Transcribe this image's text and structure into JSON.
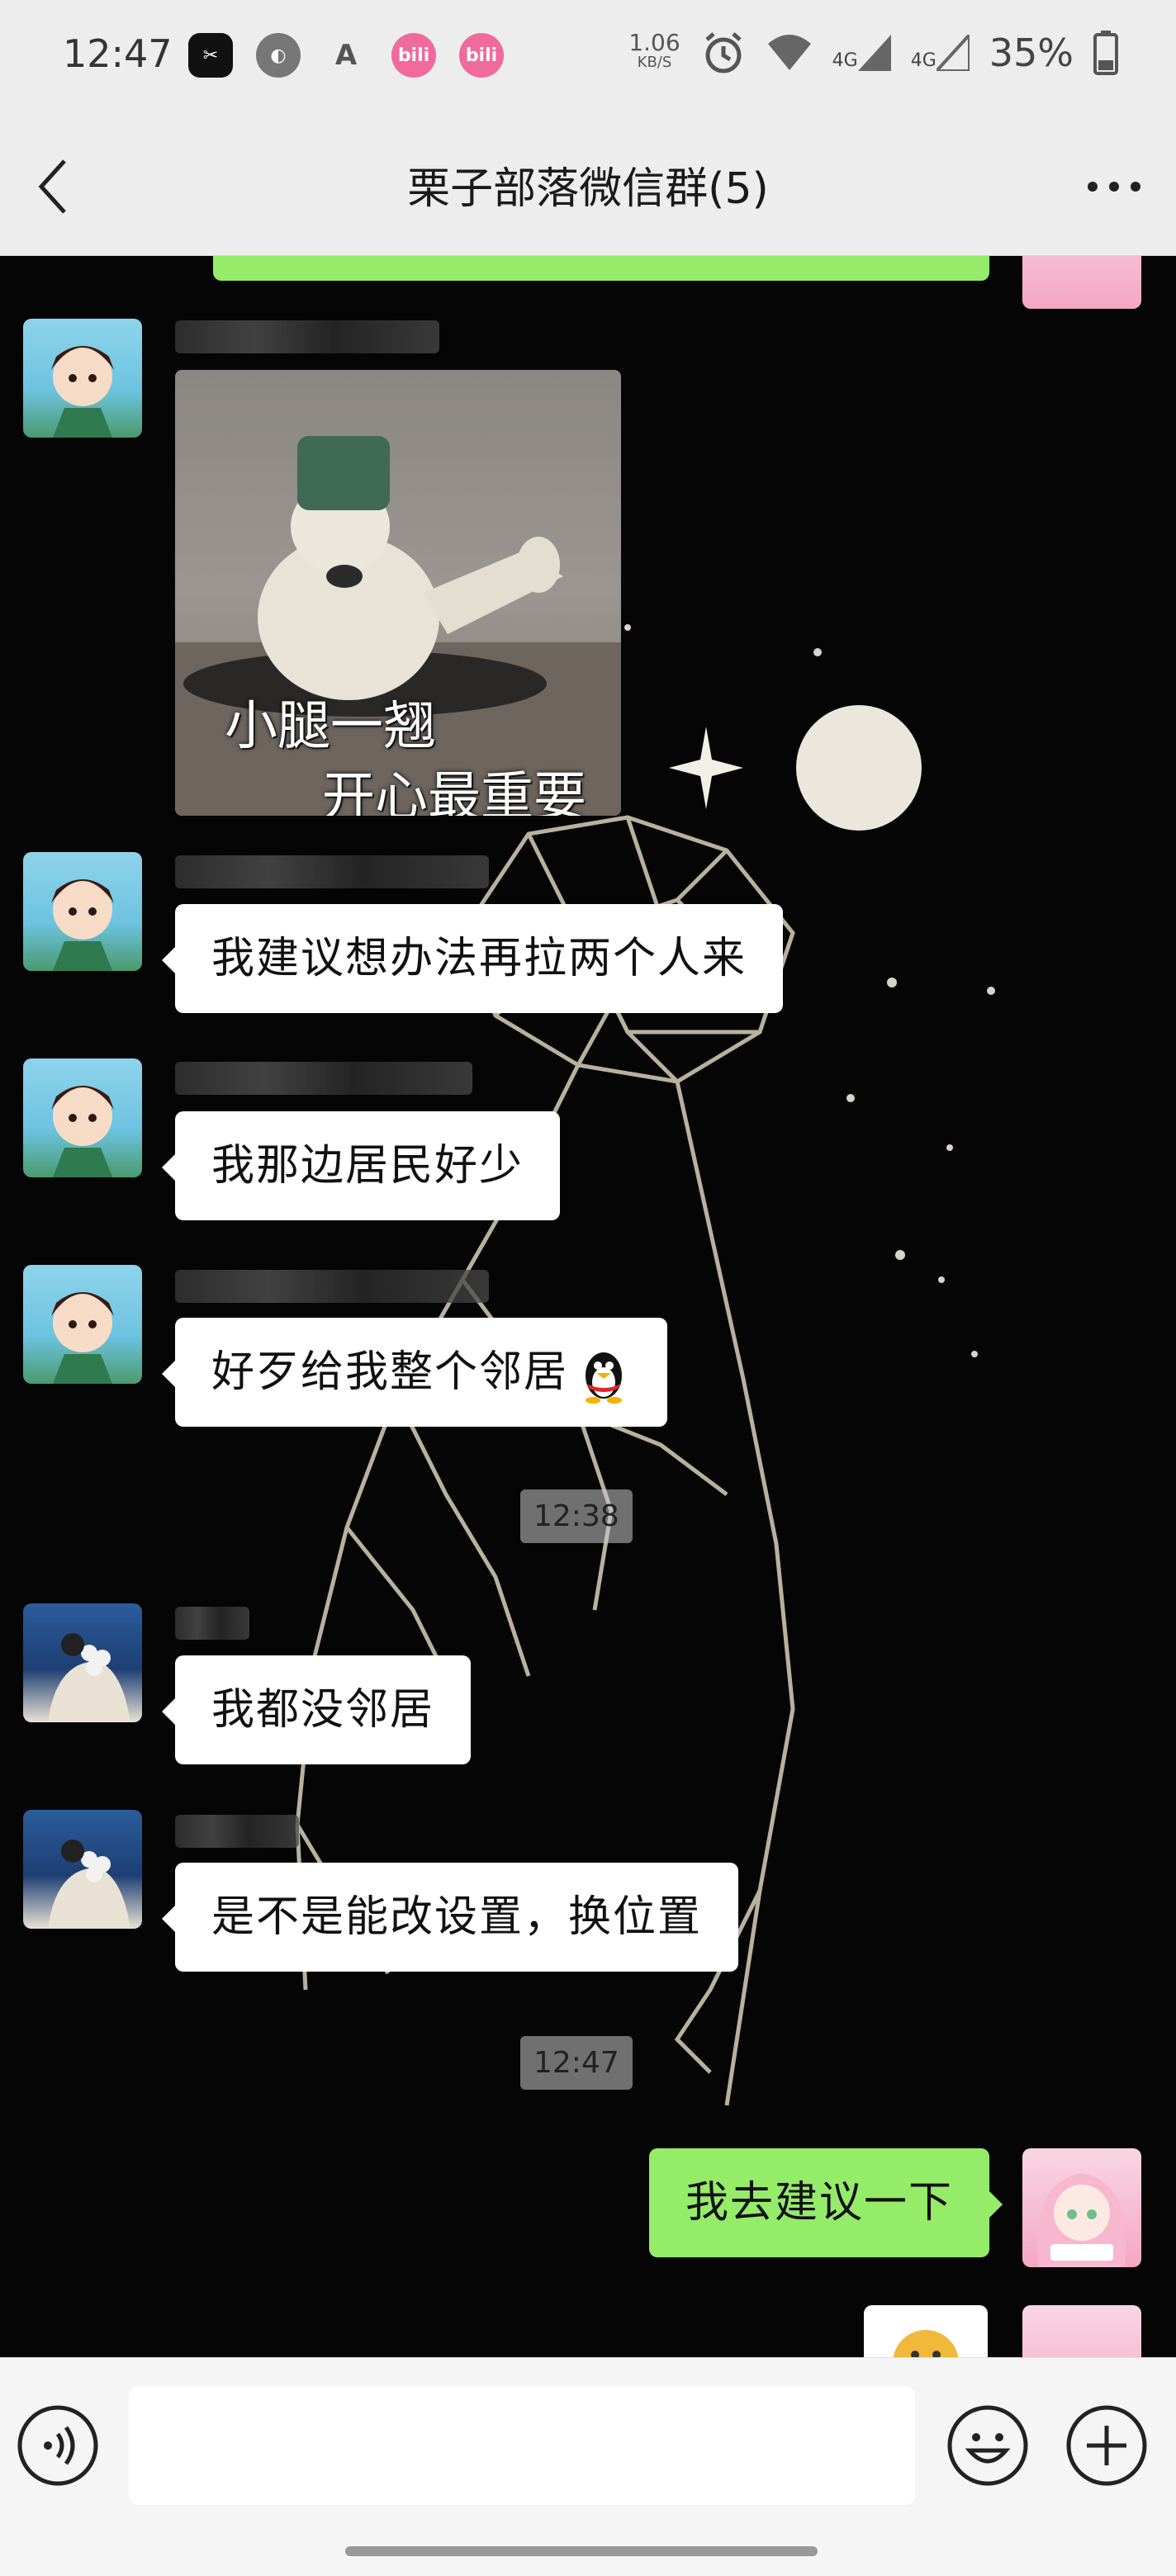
{
  "status_bar": {
    "time": "12:47",
    "net_speed_value": "1.06",
    "net_speed_unit": "KB/S",
    "battery": "35%",
    "signal_1": "4G",
    "signal_2": "4G",
    "app_icons": [
      "capcut-icon",
      "moon-icon",
      "font-icon",
      "bilibili-icon",
      "bilibili-icon"
    ]
  },
  "header": {
    "title": "栗子部落微信群(5)"
  },
  "messages": [
    {
      "type": "sticker",
      "sender_side": "left",
      "line1": "小腿一翘",
      "line2": "开心最重要"
    },
    {
      "type": "text",
      "sender_side": "left",
      "text": "我建议想办法再拉两个人来"
    },
    {
      "type": "text",
      "sender_side": "left",
      "text": "我那边居民好少"
    },
    {
      "type": "text",
      "sender_side": "left",
      "text": "好歹给我整个邻居"
    },
    {
      "type": "time",
      "text": "12:38"
    },
    {
      "type": "text",
      "sender_side": "left",
      "text": "我都没邻居"
    },
    {
      "type": "text",
      "sender_side": "left",
      "text": "是不是能改设置，换位置"
    },
    {
      "type": "time",
      "text": "12:47"
    },
    {
      "type": "text",
      "sender_side": "right",
      "text": "我去建议一下"
    }
  ],
  "input_bar": {
    "placeholder": ""
  },
  "colors": {
    "my_bubble": "#95ec69",
    "their_bubble": "#ffffff",
    "bar_bg": "#ededed"
  }
}
